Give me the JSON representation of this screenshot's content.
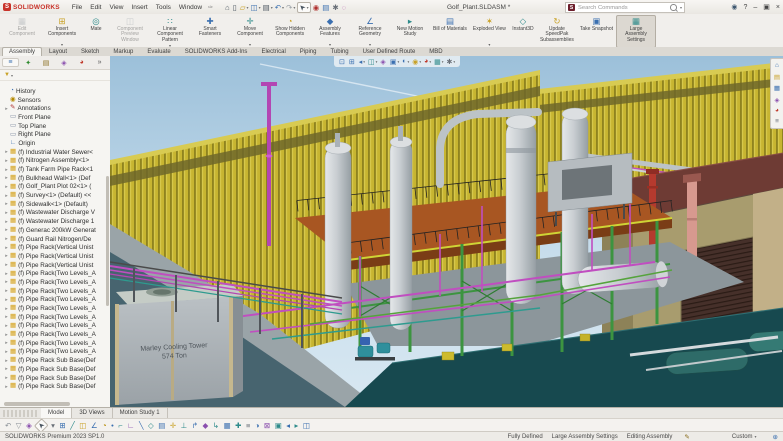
{
  "titlebar": {
    "logo_mark": "S",
    "logo_text": "SOLIDWORKS",
    "menus": [
      "File",
      "Edit",
      "View",
      "Insert",
      "Tools",
      "Window"
    ],
    "pin_glyph": "✑",
    "quick_access": [
      {
        "name": "home-icon",
        "g": "⌂",
        "c": "#4a5560"
      },
      {
        "name": "new-document-icon",
        "g": "▯",
        "c": "#4a5560"
      },
      {
        "name": "open-icon",
        "g": "▱",
        "c": "#c9a227",
        "arrow": "▾"
      },
      {
        "name": "save-icon",
        "g": "◫",
        "c": "#3a6fb0",
        "arrow": "▾"
      },
      {
        "name": "print-icon",
        "g": "▤",
        "c": "#4a5560",
        "arrow": "▾"
      },
      {
        "name": "undo-icon",
        "g": "↶",
        "c": "#3a6fb0",
        "arrow": "▾"
      },
      {
        "name": "redo-icon",
        "g": "↷",
        "c": "#9aa0a6",
        "arrow": "▾"
      },
      {
        "name": "select-icon",
        "g": "➤",
        "c": "#4a5560",
        "rot": "225",
        "sel": "boxed",
        "arrow": "▾"
      },
      {
        "name": "rebuild-icon",
        "g": "◉",
        "c": "#b0302e"
      },
      {
        "name": "file-properties-icon",
        "g": "▤",
        "c": "#3a6fb0"
      },
      {
        "name": "options-icon",
        "g": "✱",
        "c": "#6a7078"
      },
      {
        "name": "search-highlight-icon",
        "g": "◌",
        "c": "#b052a8"
      }
    ],
    "document_title": "Golf_Plant.SLDASM *",
    "search": {
      "logo_glyph": "S",
      "placeholder": "Search Commands",
      "dropdown_glyph": "▾"
    },
    "window_icons": [
      {
        "name": "user-login-icon",
        "g": "◉",
        "c": "#3f5870"
      },
      {
        "name": "help-icon",
        "g": "?",
        "c": "#444444"
      },
      {
        "name": "minimize-icon",
        "g": "–",
        "c": "#444444"
      },
      {
        "name": "restore-icon",
        "g": "▣",
        "c": "#444444"
      },
      {
        "name": "close-icon",
        "g": "×",
        "c": "#444444"
      }
    ]
  },
  "ribbon": {
    "buttons": [
      {
        "label": "Edit Component",
        "g": "▦",
        "c": "#9aa0a6",
        "state": "disabled",
        "sep": "1"
      },
      {
        "label": "Insert Components",
        "g": "⊞",
        "c": "#c9a227",
        "arrow_glyph": "▾"
      },
      {
        "label": "Mate",
        "g": "◎",
        "c": "#2e8b8b"
      },
      {
        "label": "Component Preview Window",
        "g": "◫",
        "c": "#9aa0a6",
        "state": "disabled"
      },
      {
        "label": "Linear Component Pattern",
        "g": "∷",
        "c": "#2e8b8b",
        "arrow_glyph": "▾"
      },
      {
        "label": "Smart Fasteners",
        "g": "✚",
        "c": "#3a6fb0"
      },
      {
        "label": "Move Component",
        "g": "✛",
        "c": "#2e8b8b",
        "arrow_glyph": "▾",
        "sep": "1"
      },
      {
        "label": "Show Hidden Components",
        "g": "◔",
        "c": "#c9a227"
      },
      {
        "label": "Assembly Features",
        "g": "◆",
        "c": "#3a6fb0",
        "arrow_glyph": "▾"
      },
      {
        "label": "Reference Geometry",
        "g": "∠",
        "c": "#3a6fb0",
        "arrow_glyph": "▾"
      },
      {
        "label": "New Motion Study",
        "g": "▸",
        "c": "#2e8b8b"
      },
      {
        "label": "Bill of Materials",
        "g": "▤",
        "c": "#3a6fb0"
      },
      {
        "label": "Exploded View",
        "g": "✶",
        "c": "#c9a227",
        "arrow_glyph": "▾"
      },
      {
        "label": "Instant3D",
        "g": "◇",
        "c": "#2e8b8b",
        "sep": "1"
      },
      {
        "label": "Update SpeedPak Subassemblies",
        "g": "↻",
        "c": "#c9a227"
      },
      {
        "label": "Take Snapshot",
        "g": "▣",
        "c": "#3a6fb0",
        "sep": "1"
      },
      {
        "label": "Large Assembly Settings",
        "g": "▦",
        "c": "#2e8b8b",
        "state": "active"
      }
    ]
  },
  "tabs": [
    {
      "label": "Assembly",
      "state": "active"
    },
    {
      "label": "Layout"
    },
    {
      "label": "Sketch"
    },
    {
      "label": "Markup"
    },
    {
      "label": "Evaluate"
    },
    {
      "label": "SOLIDWORKS Add-Ins"
    },
    {
      "label": "Electrical"
    },
    {
      "label": "Piping"
    },
    {
      "label": "Tubing"
    },
    {
      "label": "User Defined Route"
    },
    {
      "label": "MBD"
    }
  ],
  "feature_tree": {
    "panel_tabs": [
      {
        "name": "featuremanager-tree-tab",
        "g": "≡",
        "c": "#3a6fb0",
        "state": "active"
      },
      {
        "name": "propertymanager-tab",
        "g": "✦",
        "c": "#2e8b2e"
      },
      {
        "name": "configurationmanager-tab",
        "g": "▤",
        "c": "#8a6d1e"
      },
      {
        "name": "dimxpertmanager-tab",
        "g": "◈",
        "c": "#8a4fae"
      },
      {
        "name": "displaymanager-tab",
        "g": "◕",
        "c": "#c0392b"
      },
      {
        "name": "panel-overflow-arrow",
        "g": "»",
        "c": "#555555"
      }
    ],
    "filter_glyph": "▼",
    "filter_color": "#c9a227",
    "items": [
      {
        "icon": "history",
        "label": "History"
      },
      {
        "icon": "sensors",
        "label": "Sensors"
      },
      {
        "icon": "annotations",
        "label": "Annotations",
        "arrow_glyph": "▸"
      },
      {
        "icon": "plane",
        "label": "Front Plane"
      },
      {
        "icon": "plane",
        "label": "Top Plane"
      },
      {
        "icon": "plane",
        "label": "Right Plane"
      },
      {
        "icon": "origin",
        "label": "Origin"
      },
      {
        "icon": "component",
        "label": "(f) Industrial Water Sewer<",
        "arrow_glyph": "▸"
      },
      {
        "icon": "component",
        "label": "(f) Nitrogen Assembly<1>",
        "arrow_glyph": "▸"
      },
      {
        "icon": "component",
        "label": "(f) Tank Farm Pipe Rack<1",
        "arrow_glyph": "▸"
      },
      {
        "icon": "component",
        "label": "(f) Bulkhead Wall<1> (Def",
        "arrow_glyph": "▸"
      },
      {
        "icon": "component",
        "label": "(f) Golf_Plant Plot 02<1> (",
        "arrow_glyph": "▸"
      },
      {
        "icon": "component",
        "label": "(f) Survey<1> (Default) <<",
        "arrow_glyph": "▸"
      },
      {
        "icon": "component",
        "label": "(f) Sidewalk<1> (Default)",
        "arrow_glyph": "▸"
      },
      {
        "icon": "component",
        "label": "(f) Wastewater Discharge V",
        "arrow_glyph": "▸"
      },
      {
        "icon": "component",
        "label": "(f) Wastewater Discharge 1",
        "arrow_glyph": "▸"
      },
      {
        "icon": "component",
        "label": "(f) Generac 200kW Generat",
        "arrow_glyph": "▸"
      },
      {
        "icon": "component",
        "label": "(f) Guard Rail Nitrogen/De",
        "arrow_glyph": "▸"
      },
      {
        "icon": "component",
        "label": "(f) Pipe Rack(Vertical Unist",
        "arrow_glyph": "▸"
      },
      {
        "icon": "component",
        "label": "(f) Pipe Rack(Vertical Unist",
        "arrow_glyph": "▸"
      },
      {
        "icon": "component",
        "label": "(f) Pipe Rack(Vertical Unist",
        "arrow_glyph": "▸"
      },
      {
        "icon": "component",
        "label": "(f) Pipe Rack(Two Levels_A",
        "arrow_glyph": "▸"
      },
      {
        "icon": "component",
        "label": "(f) Pipe Rack(Two Levels_A",
        "arrow_glyph": "▸"
      },
      {
        "icon": "component",
        "label": "(f) Pipe Rack(Two Levels_A",
        "arrow_glyph": "▸"
      },
      {
        "icon": "component",
        "label": "(f) Pipe Rack(Two Levels_A",
        "arrow_glyph": "▸"
      },
      {
        "icon": "component",
        "label": "(f) Pipe Rack(Two Levels_A",
        "arrow_glyph": "▸"
      },
      {
        "icon": "component",
        "label": "(f) Pipe Rack(Two Levels_A",
        "arrow_glyph": "▸"
      },
      {
        "icon": "component",
        "label": "(f) Pipe Rack(Two Levels_A",
        "arrow_glyph": "▸"
      },
      {
        "icon": "component",
        "label": "(f) Pipe Rack(Two Levels_A",
        "arrow_glyph": "▸"
      },
      {
        "icon": "component",
        "label": "(f) Pipe Rack(Two Levels_A",
        "arrow_glyph": "▸"
      },
      {
        "icon": "component",
        "label": "(f) Pipe Rack(Two Levels_A",
        "arrow_glyph": "▸"
      },
      {
        "icon": "component",
        "label": "(f) Pipe Rack Sub Base(Def",
        "arrow_glyph": "▸"
      },
      {
        "icon": "component",
        "label": "(f) Pipe Rack Sub Base(Def",
        "arrow_glyph": "▸"
      },
      {
        "icon": "component",
        "label": "(f) Pipe Rack Sub Base(Def",
        "arrow_glyph": "▸"
      },
      {
        "icon": "component",
        "label": "(f) Pipe Rack Sub Base(Def",
        "arrow_glyph": "▸"
      }
    ]
  },
  "viewport": {
    "headsup": [
      {
        "name": "zoom-fit-icon",
        "g": "⊡",
        "c": "#3a6fb0"
      },
      {
        "name": "zoom-area-icon",
        "g": "⊞",
        "c": "#3a6fb0"
      },
      {
        "name": "previous-view-icon",
        "g": "◂",
        "c": "#3a6fb0",
        "arrow": "▾"
      },
      {
        "name": "section-view-icon",
        "g": "◫",
        "c": "#2e8b8b",
        "arrow": "▾"
      },
      {
        "name": "dynamic-annotation-icon",
        "g": "◈",
        "c": "#8a4fae"
      },
      {
        "name": "view-orientation-icon",
        "g": "▣",
        "c": "#3a6fb0",
        "arrow": "▾"
      },
      {
        "name": "display-style-icon",
        "g": "◐",
        "c": "#3a6fb0",
        "arrow": "▾"
      },
      {
        "name": "hide-show-items-icon",
        "g": "◉",
        "c": "#c9a227",
        "arrow": "▾"
      },
      {
        "name": "edit-appearance-icon",
        "g": "◕",
        "c": "#c0392b",
        "arrow": "▾"
      },
      {
        "name": "apply-scene-icon",
        "g": "▦",
        "c": "#2e8b8b",
        "arrow": "▾"
      },
      {
        "name": "view-settings-icon",
        "g": "✱",
        "c": "#6a7078",
        "arrow": "▾"
      }
    ],
    "taskpane": [
      {
        "name": "solidworks-resources-icon",
        "g": "⌂",
        "c": "#3a6fb0"
      },
      {
        "name": "design-library-icon",
        "g": "▤",
        "c": "#c9a227"
      },
      {
        "name": "file-explorer-icon",
        "g": "▦",
        "c": "#3a6fb0"
      },
      {
        "name": "view-palette-icon",
        "g": "◈",
        "c": "#8a4fae"
      },
      {
        "name": "appearances-icon",
        "g": "◕",
        "c": "#c0392b"
      },
      {
        "name": "custom-properties-icon",
        "g": "≡",
        "c": "#6a7078"
      }
    ],
    "cooling_tower_label": {
      "line1": "Marley Cooling Tower",
      "line2": "574 Ton"
    },
    "colors": {
      "sky": "#9cc0da",
      "wall_yellow": "#c7b531",
      "deck_orange": "#a85622",
      "structure_green": "#3c9440",
      "pipe_magenta": "#c04ec0",
      "vessel_gray": "#c3c9cd",
      "building_tan": "#a89c6e",
      "roof_brown": "#6e3b34",
      "ground_teal": "#17494f",
      "tower_gray": "#aeb6ba"
    }
  },
  "document_tabs": [
    {
      "label": "Model",
      "state": "active"
    },
    {
      "label": "3D Views"
    },
    {
      "label": "Motion Study 1"
    }
  ],
  "bottom_toolbar": [
    {
      "g": "↶",
      "c": "#8a9097"
    },
    {
      "g": "▽",
      "c": "#8a9097"
    },
    {
      "g": "◈",
      "c": "#8a4fae"
    },
    {
      "g": "➤",
      "c": "#4a5560",
      "rot": "225",
      "sel": "boxed"
    },
    {
      "g": "▾",
      "c": "#6a7078"
    },
    {
      "g": "⊞",
      "c": "#3a6fb0"
    },
    {
      "g": "╱",
      "c": "#2e8b8b"
    },
    {
      "g": "◫",
      "c": "#c9a227"
    },
    {
      "g": "∠",
      "c": "#3a6fb0"
    },
    {
      "g": "◔",
      "c": "#b58900"
    },
    {
      "g": "•",
      "c": "#3a6fb0"
    },
    {
      "g": "⌐",
      "c": "#2e8b8b"
    },
    {
      "g": "∟",
      "c": "#8a4fae"
    },
    {
      "g": "╲",
      "c": "#3a6fb0"
    },
    {
      "g": "◇",
      "c": "#2e8b8b"
    },
    {
      "g": "▤",
      "c": "#3a6fb0"
    },
    {
      "g": "✛",
      "c": "#c9a227"
    },
    {
      "g": "⊥",
      "c": "#2e8b8b"
    },
    {
      "g": "↱",
      "c": "#3a6fb0"
    },
    {
      "g": "◆",
      "c": "#8a4fae"
    },
    {
      "g": "↳",
      "c": "#2e8b8b"
    },
    {
      "g": "▦",
      "c": "#3a6fb0"
    },
    {
      "g": "✚",
      "c": "#2e8b8b"
    },
    {
      "g": "≡",
      "c": "#6a7078"
    },
    {
      "g": "◑",
      "c": "#3a6fb0"
    },
    {
      "g": "⊠",
      "c": "#8a4fae"
    },
    {
      "g": "▣",
      "c": "#2e8b8b"
    },
    {
      "g": "◂",
      "c": "#3a6fb0"
    },
    {
      "g": "▸",
      "c": "#2e8b8b"
    },
    {
      "g": "◫",
      "c": "#3a6fb0"
    }
  ],
  "statusbar": {
    "product": "SOLIDWORKS Premium 2023 SP1.0",
    "items": [
      "Fully Defined",
      "Large Assembly Settings",
      "Editing Assembly"
    ],
    "edit_glyph": "✎",
    "custom_label": "Custom",
    "dropdown_glyph": "▾",
    "globe_glyph": "⊕"
  }
}
